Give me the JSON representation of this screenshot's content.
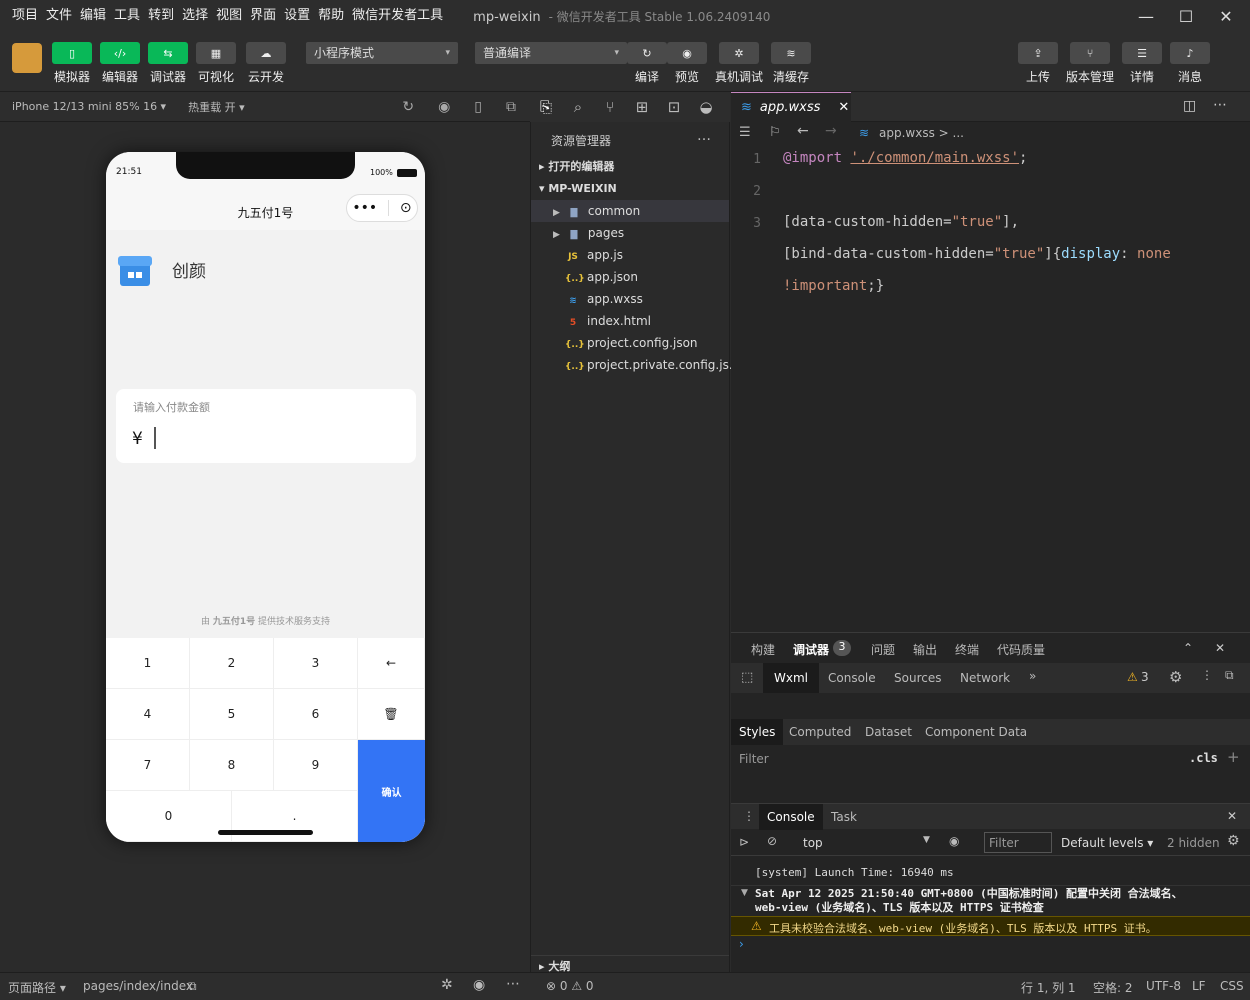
{
  "menus": [
    "项目",
    "文件",
    "编辑",
    "工具",
    "转到",
    "选择",
    "视图",
    "界面",
    "设置",
    "帮助",
    "微信开发者工具"
  ],
  "app_title": {
    "project": "mp-weixin",
    "rest": "- 微信开发者工具 Stable 1.06.2409140"
  },
  "toolbar": {
    "left": [
      "模拟器",
      "编辑器",
      "调试器",
      "可视化",
      "云开发"
    ],
    "mode_select": "小程序模式",
    "compile_select": "普通编译",
    "mid": [
      "编译",
      "预览",
      "真机调试",
      "清缓存"
    ],
    "right": [
      "上传",
      "版本管理",
      "详情",
      "消息"
    ]
  },
  "sim": {
    "device": "iPhone 12/13 mini 85% 16 ▾",
    "hotreload": "热重载 开 ▾"
  },
  "phone": {
    "time": "21:51",
    "battery": "100%",
    "nav_title": "九五付1号",
    "shop_name": "创颜",
    "amount_label": "请输入付款金额",
    "currency": "¥",
    "support_prefix": "由",
    "support_name": "九五付1号",
    "support_suffix": "提供技术服务支持",
    "keys": [
      "1",
      "2",
      "3",
      "←",
      "4",
      "5",
      "6",
      "🗑",
      "7",
      "8",
      "9",
      "0",
      "."
    ],
    "confirm": "确认"
  },
  "explorer": {
    "title": "资源管理器",
    "open_editors": "打开的编辑器",
    "root": "MP-WEIXIN",
    "items": [
      {
        "name": "common",
        "kind": "folder"
      },
      {
        "name": "pages",
        "kind": "folder"
      },
      {
        "name": "app.js",
        "kind": "js"
      },
      {
        "name": "app.json",
        "kind": "json"
      },
      {
        "name": "app.wxss",
        "kind": "wxss"
      },
      {
        "name": "index.html",
        "kind": "html"
      },
      {
        "name": "project.config.json",
        "kind": "json"
      },
      {
        "name": "project.private.config.js...",
        "kind": "json"
      }
    ],
    "outline": "大纲"
  },
  "editor": {
    "tab": "app.wxss",
    "crumb": "app.wxss > ...",
    "lines": [
      {
        "n": "1",
        "parts": [
          [
            "@import ",
            "#c586c0"
          ],
          [
            "'./common/main.wxss'",
            "#ce9178"
          ],
          [
            ";",
            "#ccc"
          ]
        ]
      },
      {
        "n": "2",
        "parts": []
      },
      {
        "n": "3",
        "parts": [
          [
            "[data-custom-hidden=",
            "#ccc"
          ],
          [
            "\"true\"",
            "#ce9178"
          ],
          [
            "],",
            "#ccc"
          ]
        ]
      },
      {
        "n": "",
        "parts": [
          [
            "[bind-data-custom-hidden=",
            "#ccc"
          ],
          [
            "\"true\"",
            "#ce9178"
          ],
          [
            "]{",
            "#ccc"
          ],
          [
            "display",
            "#9cdcfe"
          ],
          [
            ": ",
            "#ccc"
          ],
          [
            "none",
            "#ce9178"
          ]
        ]
      },
      {
        "n": "",
        "parts": [
          [
            "!important",
            "#ce9178"
          ],
          [
            ";}",
            "#ccc"
          ]
        ]
      }
    ]
  },
  "debug": {
    "panel_tabs": [
      "构建",
      "调试器",
      "问题",
      "输出",
      "终端",
      "代码质量"
    ],
    "debug_badge": "3",
    "dev_tabs": [
      "Wxml",
      "Console",
      "Sources",
      "Network"
    ],
    "warn_count": "3",
    "style_tabs": [
      "Styles",
      "Computed",
      "Dataset",
      "Component Data"
    ],
    "filter": "Filter",
    "cls": ".cls",
    "console_tabs": [
      "Console",
      "Task"
    ],
    "context": "top",
    "filter2": "Filter",
    "levels": "Default levels ▾",
    "hidden": "2 hidden",
    "log1": "[system] Launch Time: 16940 ms",
    "log2": "Sat Apr 12 2025 21:50:40 GMT+0800 (中国标准时间) 配置中关闭 合法域名、web-view (业务域名)、TLS 版本以及 HTTPS 证书检查",
    "warn": "工具未校验合法域名、web-view (业务域名)、TLS 版本以及 HTTPS 证书。"
  },
  "footer": {
    "path_label": "页面路径 ▾",
    "path": "pages/index/index",
    "errors": "⊗ 0 ⚠ 0",
    "pos": "行 1, 列 1",
    "spaces": "空格: 2",
    "enc": "UTF-8",
    "eol": "LF",
    "lang": "CSS"
  }
}
